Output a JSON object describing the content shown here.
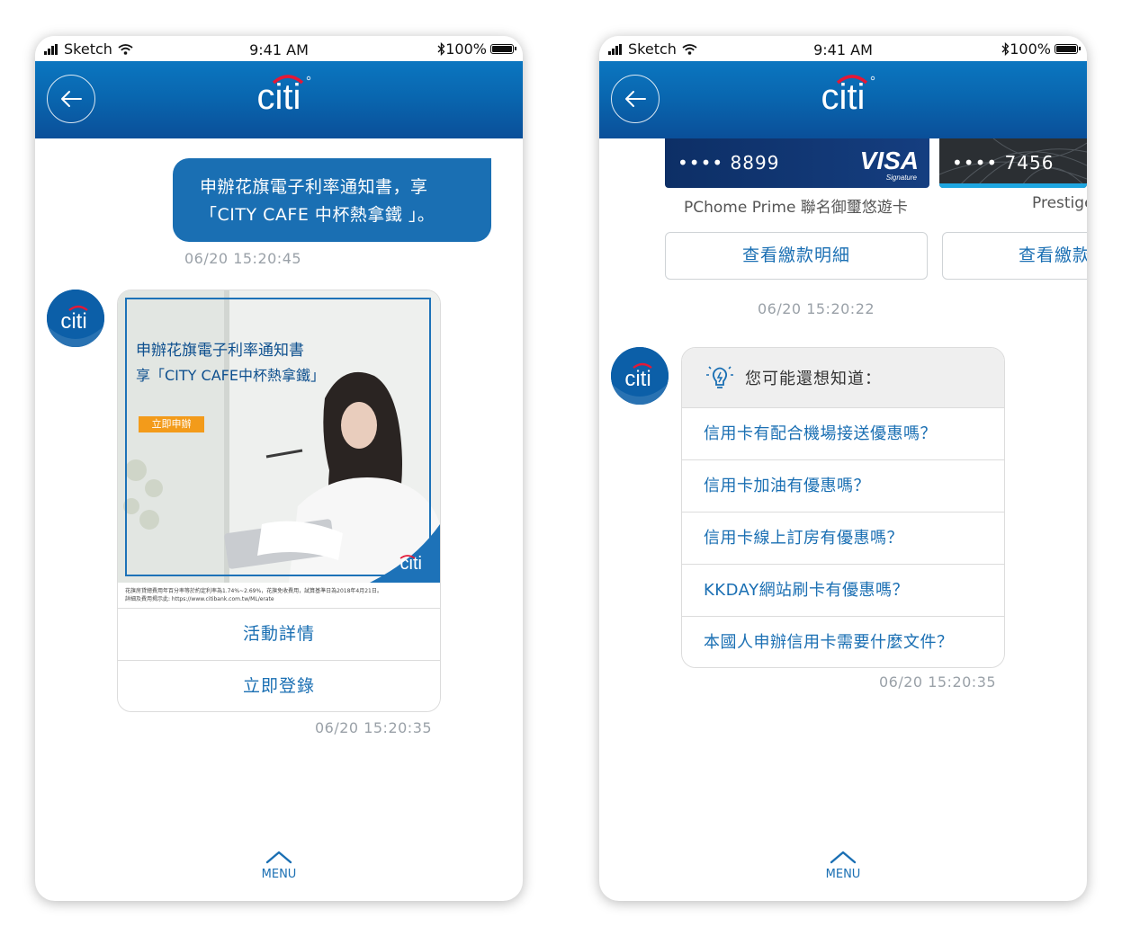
{
  "status_bar": {
    "carrier": "Sketch",
    "time": "9:41 AM",
    "battery": "100%"
  },
  "left_phone": {
    "user_message": {
      "line1": "申辦花旗電子利率通知書，享",
      "line2": "「CITY CAFE 中杯熱拿鐵 」。"
    },
    "user_message_time": "06/20  15:20:45",
    "promo": {
      "headline_line1": "申辦花旗電子利率通知書",
      "headline_line2": "享「CITY CAFE中杯熱拿鐵」",
      "apply_button": "立即申辦",
      "fine_print_line1": "花旗房貸總費用年百分率等於約定利率為1.74%~2.69%，花旗免收費用，試算基準日為2018年4月21日。",
      "fine_print_line2": "詳細及費用揭示此: https://www.citibank.com.tw/ML/erate",
      "buttons": [
        "活動詳情",
        "立即登錄"
      ]
    },
    "promo_time": "06/20  15:20:35",
    "menu_label": "MENU"
  },
  "right_phone": {
    "cards": [
      {
        "number": "•••• 8899",
        "name": "PChome Prime 聯名御璽悠遊卡",
        "button": "查看繳款明細",
        "network": "VISA",
        "network_sub": "Signature"
      },
      {
        "number": "•••• 7456",
        "name": "Prestige",
        "button": "查看繳款明細"
      }
    ],
    "cards_time": "06/20  15:20:22",
    "suggestions": {
      "title": "您可能還想知道：",
      "items": [
        "信用卡有配合機場接送優惠嗎？",
        "信用卡加油有優惠嗎？",
        "信用卡線上訂房有優惠嗎？",
        "KKDAY網站刷卡有優惠嗎？",
        "本國人申辦信用卡需要什麼文件？"
      ]
    },
    "suggestions_time": "06/20  15:20:35",
    "menu_label": "MENU"
  },
  "colors": {
    "brand_blue": "#1a6fb3",
    "header_blue": "#0a64ad",
    "citi_red": "#e31837",
    "promo_orange": "#f39b1a"
  },
  "icons": [
    "signal-icon",
    "wifi-icon",
    "bluetooth-icon",
    "battery-icon",
    "back-arrow-icon",
    "citi-logo",
    "chevron-up-icon",
    "lightbulb-icon",
    "visa-logo"
  ]
}
